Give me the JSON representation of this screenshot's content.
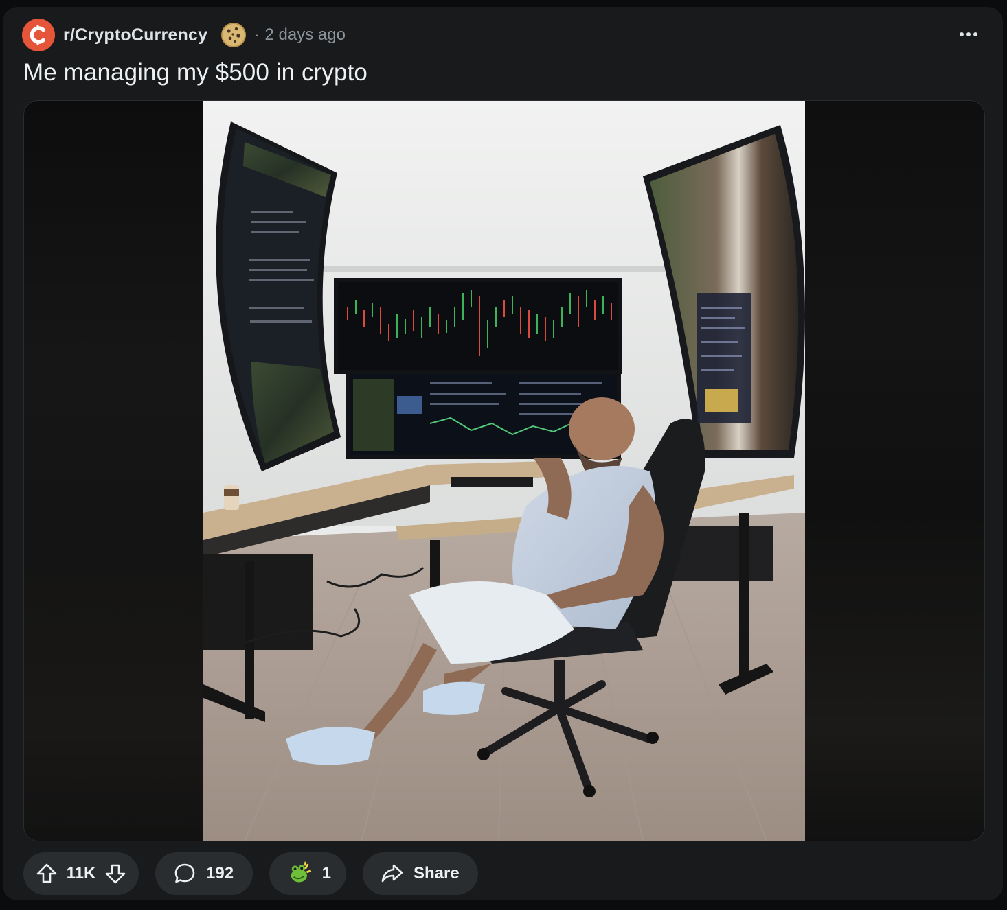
{
  "post": {
    "subreddit": "r/CryptoCurrency",
    "separator": "·",
    "time_ago": "2 days ago",
    "title": "Me managing my $500 in crypto"
  },
  "icons": {
    "subreddit_avatar": "crypto-c-icon",
    "community_award": "cookie-award-icon",
    "more": "ellipsis-icon",
    "upvote": "arrow-up-icon",
    "downvote": "arrow-down-icon",
    "comments": "speech-bubble-icon",
    "award": "frog-award-icon",
    "share": "share-arrow-icon"
  },
  "actions": {
    "score": "11K",
    "comments": "192",
    "awards": "1",
    "share_label": "Share"
  },
  "colors": {
    "background": "#0b0c0d",
    "card": "#181a1c",
    "pill": "#2a2d30",
    "avatar": "#e4553a",
    "text_primary": "#eef1f3",
    "text_secondary": "#8b949b"
  }
}
